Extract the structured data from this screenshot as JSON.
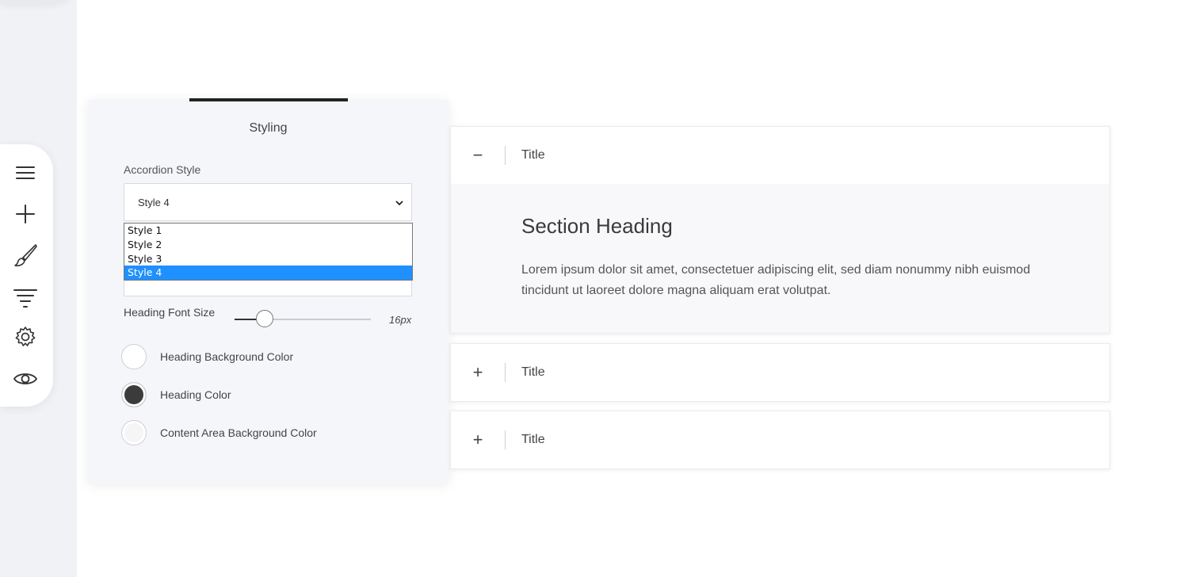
{
  "toolbar": {
    "items": [
      {
        "icon": "hamburger-menu-icon"
      },
      {
        "icon": "plus-icon"
      },
      {
        "icon": "paintbrush-icon"
      },
      {
        "icon": "filter-icon"
      },
      {
        "icon": "gear-icon"
      },
      {
        "icon": "eye-icon"
      }
    ]
  },
  "panel": {
    "title": "Styling",
    "accordion_style": {
      "label": "Accordion Style",
      "selected": "Style 4",
      "options": [
        "Style 1",
        "Style 2",
        "Style 3",
        "Style 4"
      ],
      "highlighted_index": 3
    },
    "heading_font_size": {
      "label": "Heading Font Size",
      "value": "16px"
    },
    "colors": [
      {
        "label": "Heading Background Color",
        "color": "#ffffff"
      },
      {
        "label": "Heading Color",
        "color": "#3b3b3b"
      },
      {
        "label": "Content Area Background Color",
        "color": "#f5f5f5"
      }
    ]
  },
  "accordion": {
    "items": [
      {
        "toggle": "−",
        "title": "Title",
        "expanded": true,
        "content_heading": "Section Heading",
        "content_text": "Lorem ipsum dolor sit amet, consectetuer adipiscing elit, sed diam nonummy nibh euismod tincidunt ut laoreet dolore magna aliquam erat volutpat."
      },
      {
        "toggle": "+",
        "title": "Title",
        "expanded": false
      },
      {
        "toggle": "+",
        "title": "Title",
        "expanded": false
      }
    ]
  },
  "colors": {
    "selected_option_bg": "#1e90ff",
    "sidebar_bg": "#f1f2f6",
    "panel_bg": "#f5f6f9"
  }
}
